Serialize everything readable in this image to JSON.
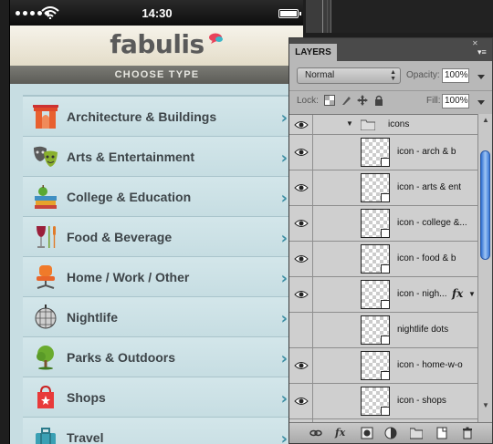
{
  "phone": {
    "status": {
      "time": "14:30"
    },
    "brand": {
      "logo_text": "fabulis"
    },
    "subheader": "CHOOSE TYPE",
    "categories": [
      {
        "label": "Architecture & Buildings",
        "icon": "arch-icon"
      },
      {
        "label": "Arts & Entertainment",
        "icon": "theatre-masks-icon"
      },
      {
        "label": "College & Education",
        "icon": "books-apple-icon"
      },
      {
        "label": "Food & Beverage",
        "icon": "wine-cutlery-icon"
      },
      {
        "label": "Home / Work / Other",
        "icon": "office-chair-icon"
      },
      {
        "label": "Nightlife",
        "icon": "disco-ball-icon"
      },
      {
        "label": "Parks & Outdoors",
        "icon": "tree-icon"
      },
      {
        "label": "Shops",
        "icon": "shopping-bag-icon"
      },
      {
        "label": "Travel",
        "icon": "suitcase-icon"
      }
    ],
    "chevron": "›",
    "colors": {
      "list_bg": "#c7dde2",
      "chevron": "#3d8ea3",
      "text": "#3d4448"
    }
  },
  "layers_panel": {
    "tab": "LAYERS",
    "blend_mode": "Normal",
    "opacity_label": "Opacity:",
    "opacity_value": "100%",
    "lock_label": "Lock:",
    "fill_label": "Fill:",
    "fill_value": "100%",
    "group": {
      "name": "icons",
      "expanded": true
    },
    "layers": [
      {
        "name": "icon - arch & b",
        "fx": false
      },
      {
        "name": "icon - arts & ent",
        "fx": false
      },
      {
        "name": "icon - college &...",
        "fx": false
      },
      {
        "name": "icon - food & b",
        "fx": false
      },
      {
        "name": "icon - nigh...",
        "fx": true
      },
      {
        "name": "nightlife dots",
        "fx": false
      },
      {
        "name": "icon - home-w-o",
        "fx": false
      },
      {
        "name": "icon - shops",
        "fx": false
      },
      {
        "name": "",
        "fx": false
      }
    ],
    "fx_label": "fx",
    "bottom_icons": [
      "link-icon",
      "fx-icon",
      "mask-icon",
      "adjustment-icon",
      "folder-icon",
      "new-layer-icon",
      "trash-icon"
    ]
  }
}
